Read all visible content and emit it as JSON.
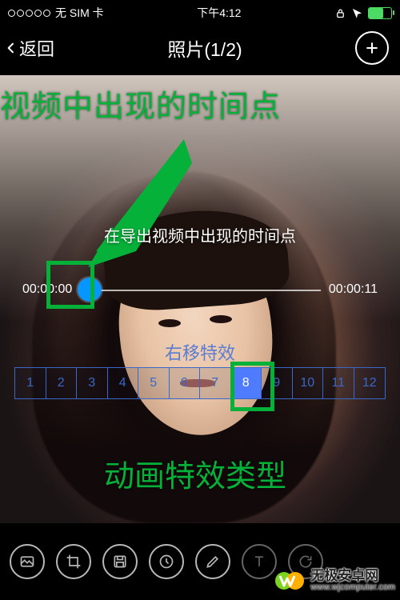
{
  "statusbar": {
    "carrier": "无 SIM 卡",
    "time": "下午4:12"
  },
  "nav": {
    "back": "返回",
    "title": "照片(1/2)"
  },
  "annotations": {
    "top": "视频中出现的时间点",
    "bottom": "动画特效类型"
  },
  "hint": "在导出视频中出现的时间点",
  "timeline": {
    "start": "00:00:00",
    "end": "00:00:11",
    "thumb_position_pct": 4
  },
  "effect": {
    "label": "右移特效",
    "options": [
      "1",
      "2",
      "3",
      "4",
      "5",
      "6",
      "7",
      "8",
      "9",
      "10",
      "11",
      "12"
    ],
    "selected_index": 7
  },
  "toolbar_icons": [
    "image-icon",
    "crop-icon",
    "save-icon",
    "clock-icon",
    "edit-icon",
    "text-icon",
    "rotate-icon"
  ],
  "watermark": {
    "line1": "无极安卓网",
    "line2": "www.wjcomputer.com"
  },
  "colors": {
    "annotation_green": "#06b13a",
    "thumb_blue": "#0597ff",
    "effect_blue": "#3a68c9",
    "selected_blue": "#4f7cff"
  }
}
